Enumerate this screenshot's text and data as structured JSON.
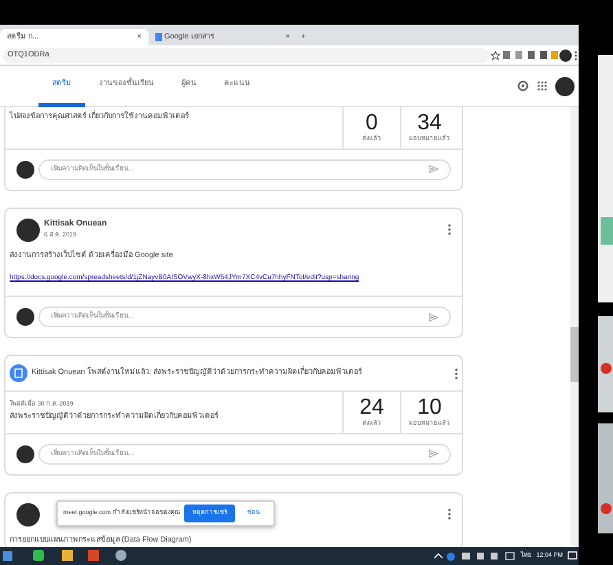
{
  "browser": {
    "tabs": [
      {
        "title": "สตรีม ก...",
        "selected": true,
        "close": "×"
      },
      {
        "title": "Google เอกสาร",
        "selected": false,
        "close": "×"
      }
    ],
    "new_tab": "+",
    "url": "OTQ1ODRa"
  },
  "nav": {
    "tabs": [
      {
        "label": "สตรีม",
        "selected": true
      },
      {
        "label": "งานของชั้นเรียน",
        "selected": false
      },
      {
        "label": "ผู้คน",
        "selected": false
      },
      {
        "label": "คะแนน",
        "selected": false
      }
    ]
  },
  "posts": [
    {
      "kind": "assignment_tail",
      "description": "ไปสองข้อการคุณศาสตร์ เกี่ยวกับการใช้งานคอมพิวเตอร์",
      "stats": [
        {
          "value": "0",
          "label": "ส่งแล้ว"
        },
        {
          "value": "34",
          "label": "มอบหมายแล้ว"
        }
      ],
      "comment_placeholder": "เพิ่มความคิดเห็นในชั้นเรียน..."
    },
    {
      "kind": "announcement",
      "author": "Kittisak Onuean",
      "date": "6 ส.ค. 2019",
      "text": "ส่งงานการสร้างเว็บไซต์ ด้วยเครื่องมือ Google site",
      "link": "https://docs.google.com/spreadsheets/d/1jZNayvB0AISOVwyX-8hxW54JYm7XC4vCu7hhyFNToI/edit?usp=sharing",
      "comment_placeholder": "เพิ่มความคิดเห็นในชั้นเรียน..."
    },
    {
      "kind": "assignment",
      "title": "Kittisak Onuean โพสต์งานใหม่แล้ว: ส่งพระราชบัญญัติว่าด้วยการกระทำความผิดเกี่ยวกับคอมพิวเตอร์",
      "posted": "โพสต์เมื่อ 30 ก.ค. 2019",
      "description": "ส่งพระราชบัญญัติว่าด้วยการกระทำความผิดเกี่ยวกับคอมพิวเตอร์",
      "stats": [
        {
          "value": "24",
          "label": "ส่งแล้ว"
        },
        {
          "value": "10",
          "label": "มอบหมายแล้ว"
        }
      ],
      "comment_placeholder": "เพิ่มความคิดเห็นในชั้นเรียน..."
    },
    {
      "kind": "announcement_partial",
      "text": "การออกแบบแผนภาพกระแสข้อมูล (Data Flow Diagram)"
    }
  ],
  "share_bar": {
    "message": "meet.google.com กำลังแชร์หน้าจอของคุณ",
    "stop": "หยุดการแชร์",
    "hide": "ซ่อน"
  },
  "taskbar": {
    "language": "ไทย",
    "time": "12:04 PM"
  }
}
